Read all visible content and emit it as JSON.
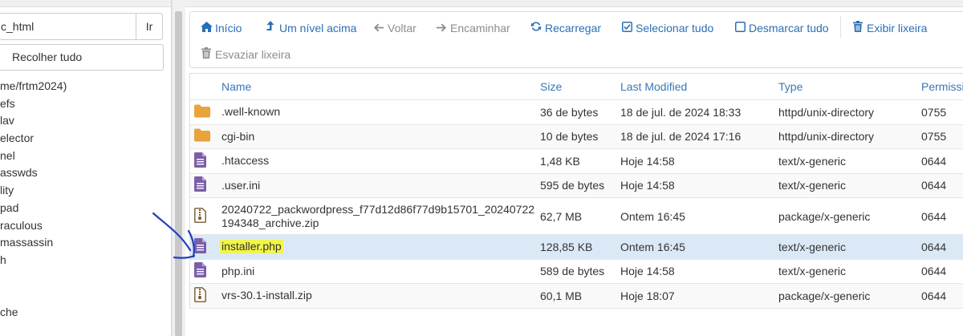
{
  "left_panel": {
    "path_value": "c_html",
    "go_label": "Ir",
    "collapse_label": "Recolher tudo",
    "tree_items": [
      "me/frtm2024)",
      "efs",
      "lav",
      "elector",
      "nel",
      "asswds",
      "lity",
      "pad",
      "raculous",
      "massassin",
      "h",
      "",
      "",
      "che"
    ]
  },
  "toolbar": {
    "home_label": "Início",
    "up_label": "Um nível acima",
    "back_label": "Voltar",
    "forward_label": "Encaminhar",
    "reload_label": "Recarregar",
    "select_all_label": "Selecionar tudo",
    "deselect_all_label": "Desmarcar tudo",
    "view_trash_label": "Exibir lixeira",
    "empty_trash_label": "Esvaziar lixeira"
  },
  "table": {
    "headers": {
      "name": "Name",
      "size": "Size",
      "modified": "Last Modified",
      "type": "Type",
      "permissions": "Permissi"
    },
    "rows": [
      {
        "icon": "folder-icon",
        "name": ".well-known",
        "size": "36 de bytes",
        "modified": "18 de jul. de 2024 18:33",
        "type": "httpd/unix-directory",
        "perms": "0755"
      },
      {
        "icon": "folder-icon",
        "name": "cgi-bin",
        "size": "10 de bytes",
        "modified": "18 de jul. de 2024 17:16",
        "type": "httpd/unix-directory",
        "perms": "0755"
      },
      {
        "icon": "file-icon",
        "name": ".htaccess",
        "size": "1,48 KB",
        "modified": "Hoje 14:58",
        "type": "text/x-generic",
        "perms": "0644"
      },
      {
        "icon": "file-icon",
        "name": ".user.ini",
        "size": "595 de bytes",
        "modified": "Hoje 14:58",
        "type": "text/x-generic",
        "perms": "0644"
      },
      {
        "icon": "zip-icon",
        "name": "20240722_packwordpress_f77d12d86f77d9b15701_20240722194348_archive.zip",
        "name_line1": "20240722_packwordpress_f77d12d86f77d9b15701_20240722",
        "name_line2": "194348_archive.zip",
        "size": "62,7 MB",
        "modified": "Ontem 16:45",
        "type": "package/x-generic",
        "perms": "0644"
      },
      {
        "icon": "file-icon",
        "name": "installer.php",
        "size": "128,85 KB",
        "modified": "Ontem 16:45",
        "type": "text/x-generic",
        "perms": "0644",
        "selected": true
      },
      {
        "icon": "file-icon",
        "name": "php.ini",
        "size": "589 de bytes",
        "modified": "Hoje 14:58",
        "type": "text/x-generic",
        "perms": "0644"
      },
      {
        "icon": "zip-icon",
        "name": "vrs-30.1-install.zip",
        "size": "60,1 MB",
        "modified": "Hoje 18:07",
        "type": "package/x-generic",
        "perms": "0644"
      }
    ]
  },
  "colors": {
    "link": "#2a6fb5",
    "header": "#3878b5",
    "folder": "#e8a33d",
    "file": "#7b5fa8",
    "selected_row": "#dbe9f7",
    "highlight": "#f2f54a",
    "annotation": "#1f3fbf"
  }
}
